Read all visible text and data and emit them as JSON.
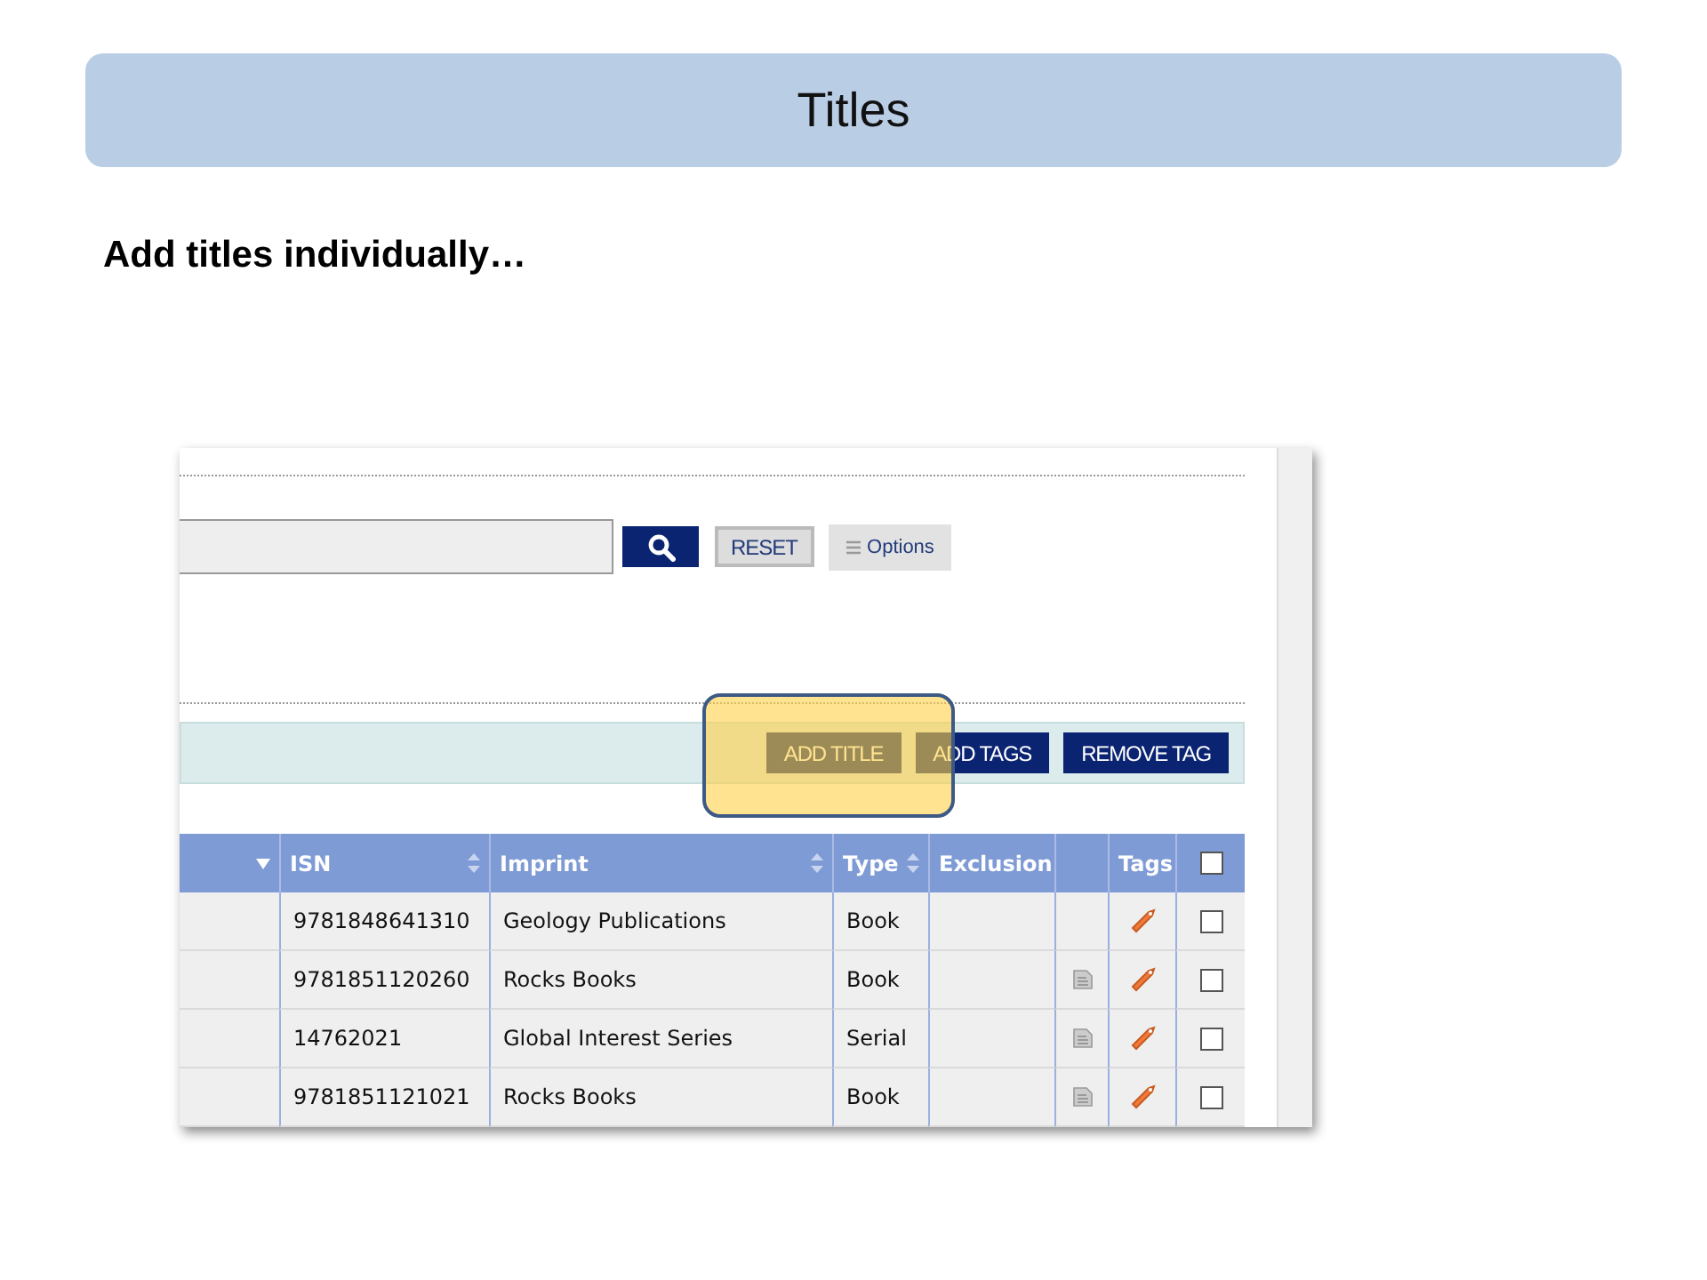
{
  "slide": {
    "title": "Titles",
    "subtitle": "Add titles individually…"
  },
  "screenshot": {
    "search": {
      "button_reset": "RESET",
      "button_options": "Options"
    },
    "toolbar": [
      {
        "label": "ADD TITLE",
        "highlighted": true
      },
      {
        "label": "ADD TAGS",
        "highlighted": false
      },
      {
        "label": "REMOVE TAG",
        "highlighted": false
      }
    ],
    "table": {
      "columns": [
        {
          "sort_active": true
        },
        {
          "label": "ISN",
          "sort_active": false
        },
        {
          "label": "Imprint",
          "sort_active": false
        },
        {
          "label": "Type",
          "sort_active": false
        },
        {
          "label": "Exclusion"
        },
        {},
        {
          "label": "Tags"
        },
        {
          "kind": "checkbox",
          "checked": false
        }
      ],
      "rows": [
        {
          "isn": "9781848641310",
          "imprint": "Geology Publications",
          "type": "Book",
          "has_note": false,
          "checked": false
        },
        {
          "isn": "9781851120260",
          "imprint": "Rocks Books",
          "type": "Book",
          "has_note": true,
          "checked": false
        },
        {
          "isn": "14762021",
          "imprint": "Global Interest Series",
          "type": "Serial",
          "has_note": true,
          "checked": false
        },
        {
          "isn": "9781851121021",
          "imprint": "Rocks Books",
          "type": "Book",
          "has_note": true,
          "checked": false
        }
      ]
    }
  }
}
